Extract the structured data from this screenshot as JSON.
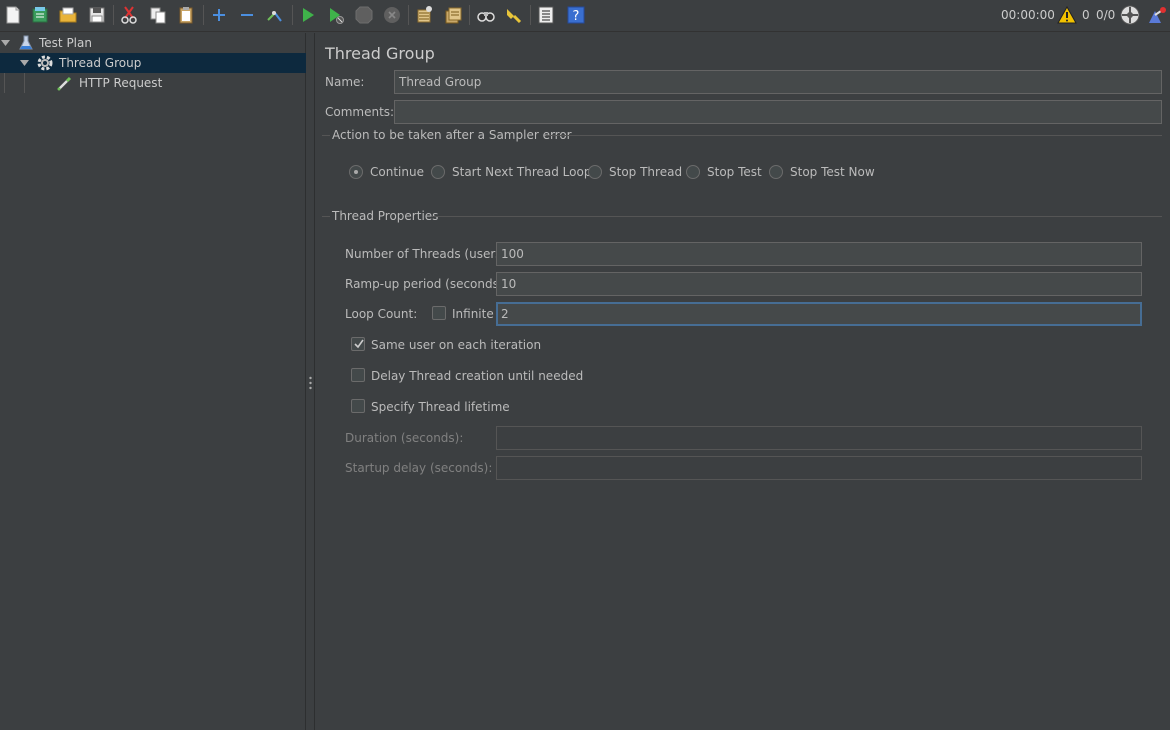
{
  "toolbar": {
    "buttons": [
      "new-icon",
      "templates-icon",
      "open-icon",
      "save-icon",
      "cut-icon",
      "copy-icon",
      "paste-icon",
      "expand-icon",
      "collapse-icon",
      "toggle-icon",
      "start-icon",
      "start-no-pause-icon",
      "stop-icon",
      "shutdown-icon",
      "clear-icon",
      "clear-all-icon",
      "search-icon",
      "reset-search-icon",
      "function-helper-icon",
      "help-icon"
    ],
    "timer": "00:00:00",
    "error_count": "0",
    "thread_count": "0/0"
  },
  "tree": {
    "items": [
      {
        "label": "Test Plan",
        "icon": "flask-icon"
      },
      {
        "label": "Thread Group",
        "icon": "gear-icon"
      },
      {
        "label": "HTTP Request",
        "icon": "pipette-icon"
      }
    ]
  },
  "panel": {
    "title": "Thread Group",
    "name_label": "Name:",
    "name_value": "Thread Group",
    "comments_label": "Comments:",
    "comments_value": "",
    "sampler_error": {
      "title": "Action to be taken after a Sampler error",
      "options": [
        "Continue",
        "Start Next Thread Loop",
        "Stop Thread",
        "Stop Test",
        "Stop Test Now"
      ],
      "selected": "Continue"
    },
    "thread_props": {
      "title": "Thread Properties",
      "threads_label": "Number of Threads (users):",
      "threads_value": "100",
      "rampup_label": "Ramp-up period (seconds):",
      "rampup_value": "10",
      "loop_label": "Loop Count:",
      "infinite_label": "Infinite",
      "infinite_checked": false,
      "loop_value": "2",
      "same_user_label": "Same user on each iteration",
      "same_user_checked": true,
      "delay_label": "Delay Thread creation until needed",
      "delay_checked": false,
      "lifetime_label": "Specify Thread lifetime",
      "lifetime_checked": false,
      "duration_label": "Duration (seconds):",
      "duration_value": "",
      "startup_label": "Startup delay (seconds):",
      "startup_value": ""
    }
  }
}
